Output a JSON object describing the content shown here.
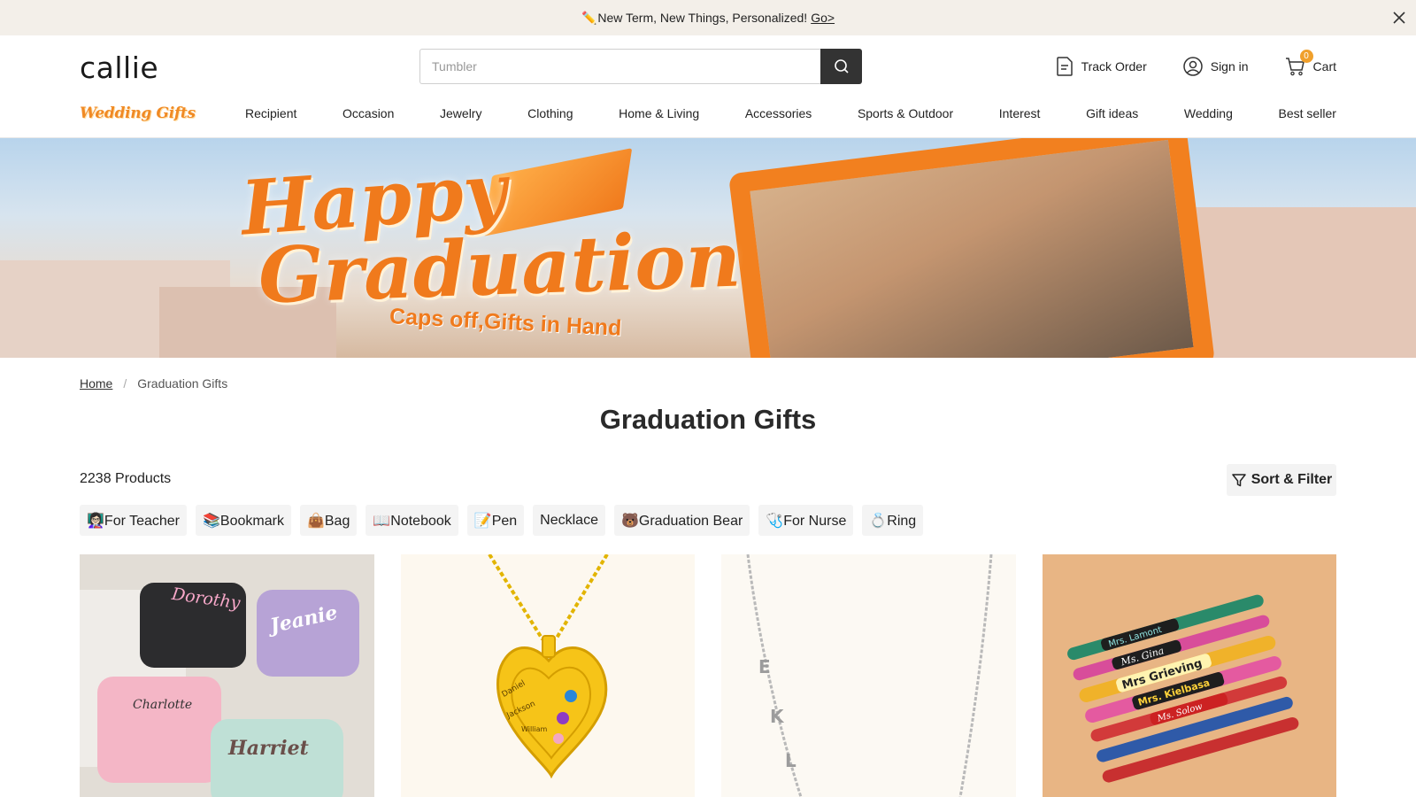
{
  "announcement": {
    "emoji": "✏️",
    "text": "New Term, New Things, Personalized!",
    "link": "Go>"
  },
  "header": {
    "logo": "callie",
    "search_placeholder": "Tumbler",
    "track_order": "Track Order",
    "sign_in": "Sign in",
    "cart_label": "Cart",
    "cart_count": "0"
  },
  "nav": {
    "wedding_logo": "Wedding Gifts",
    "items": [
      "Recipient",
      "Occasion",
      "Jewelry",
      "Clothing",
      "Home & Living",
      "Accessories",
      "Sports & Outdoor",
      "Interest",
      "Gift ideas",
      "Wedding",
      "Best seller"
    ]
  },
  "hero": {
    "line1": "Happy",
    "line2": "Graduation",
    "sub": "Caps off,Gifts in Hand"
  },
  "breadcrumb": {
    "home": "Home",
    "sep": "/",
    "current": "Graduation Gifts"
  },
  "page_title": "Graduation Gifts",
  "product_count": "2238 Products",
  "sort_filter": "Sort & Filter",
  "chips": [
    "👩🏻‍🏫For Teacher",
    "📚Bookmark",
    "👜Bag",
    "📖Notebook",
    "📝Pen",
    "Necklace",
    "🐻Graduation Bear",
    "🩺For Nurse",
    "💍Ring"
  ],
  "products": [
    {
      "names": [
        "Dorothy",
        "Jeanie",
        "Charlotte",
        "Harriet"
      ]
    },
    {
      "names": [
        "Daniel",
        "Jackson",
        "William"
      ]
    },
    {
      "letters": [
        "E",
        "K",
        "L"
      ]
    },
    {
      "names": [
        "Mrs. Lamont",
        "Ms. Gina",
        "Mrs Grieving",
        "Mrs. Kielbasa",
        "Ms. Solow"
      ]
    }
  ],
  "colors": {
    "accent": "#f07a1c",
    "announce_bg": "#f3efe9",
    "search_btn": "#333333",
    "badge": "#f0a02c"
  }
}
